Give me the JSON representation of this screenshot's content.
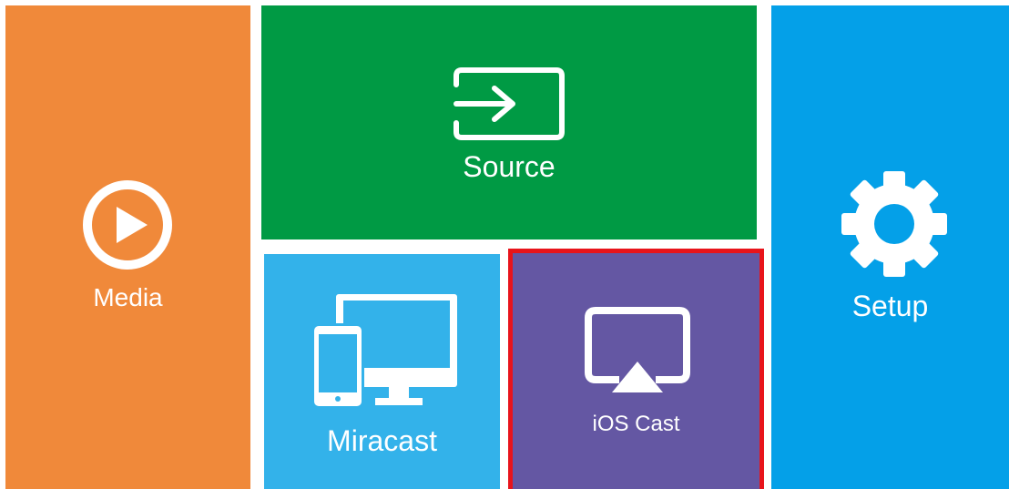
{
  "colors": {
    "media": "#f0893a",
    "source": "#009a44",
    "miracast": "#33b2ea",
    "ios_cast": "#6457a3",
    "setup": "#04a0e8",
    "selection_border": "#e8141b"
  },
  "tiles": {
    "media": {
      "label": "Media",
      "icon": "play-icon"
    },
    "source": {
      "label": "Source",
      "icon": "input-arrow-icon"
    },
    "miracast": {
      "label": "Miracast",
      "icon": "devices-icon"
    },
    "ios_cast": {
      "label": "iOS Cast",
      "icon": "airplay-icon",
      "selected": true
    },
    "setup": {
      "label": "Setup",
      "icon": "gear-icon"
    }
  }
}
